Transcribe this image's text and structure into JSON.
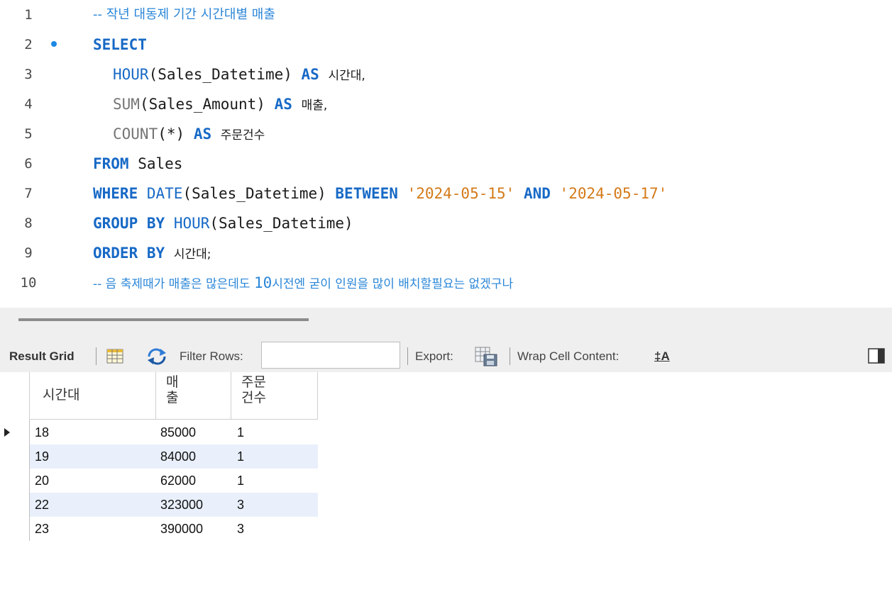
{
  "editor": {
    "lines": [
      {
        "num": "1",
        "comment": "-- 작년 대동제 기간 시간대별 매출"
      },
      {
        "num": "2",
        "kw": "SELECT"
      },
      {
        "num": "3",
        "fn": "HOUR",
        "arg": "(Sales_Datetime)",
        "kw": "AS",
        "alias": "시간대,"
      },
      {
        "num": "4",
        "fn": "SUM",
        "arg": "(Sales_Amount)",
        "kw": "AS",
        "alias": "매출,"
      },
      {
        "num": "5",
        "fn": "COUNT",
        "arg": "(*)",
        "kw": "AS",
        "alias": "주문건수"
      },
      {
        "num": "6",
        "kw": "FROM",
        "rest": "Sales"
      },
      {
        "num": "7",
        "kw": "WHERE",
        "fn": "DATE",
        "arg": "(Sales_Datetime)",
        "kw2": "BETWEEN",
        "str1": "'2024-05-15'",
        "kw3": "AND",
        "str2": "'2024-05-17'"
      },
      {
        "num": "8",
        "kw": "GROUP BY",
        "fn": "HOUR",
        "arg": "(Sales_Datetime)"
      },
      {
        "num": "9",
        "kw": "ORDER BY",
        "alias": "시간대;"
      },
      {
        "num": "10",
        "comment_a": "-- 음 축제때가 매출은 많은데도 ",
        "comment_num": "10",
        "comment_b": "시전엔 굳이 인원을 많이 배치할필요는 없겠구나"
      }
    ]
  },
  "toolbar": {
    "result_grid": "Result Grid",
    "filter_rows": "Filter Rows:",
    "filter_value": "",
    "export": "Export:",
    "wrap_cell": "Wrap Cell Content:",
    "wrap_icon_glyph": "‡A"
  },
  "grid": {
    "columns": [
      "시간대",
      "매출",
      "주문건수"
    ],
    "rows": [
      [
        "18",
        "85000",
        "1"
      ],
      [
        "19",
        "84000",
        "1"
      ],
      [
        "20",
        "62000",
        "1"
      ],
      [
        "22",
        "323000",
        "3"
      ],
      [
        "23",
        "390000",
        "3"
      ]
    ]
  }
}
